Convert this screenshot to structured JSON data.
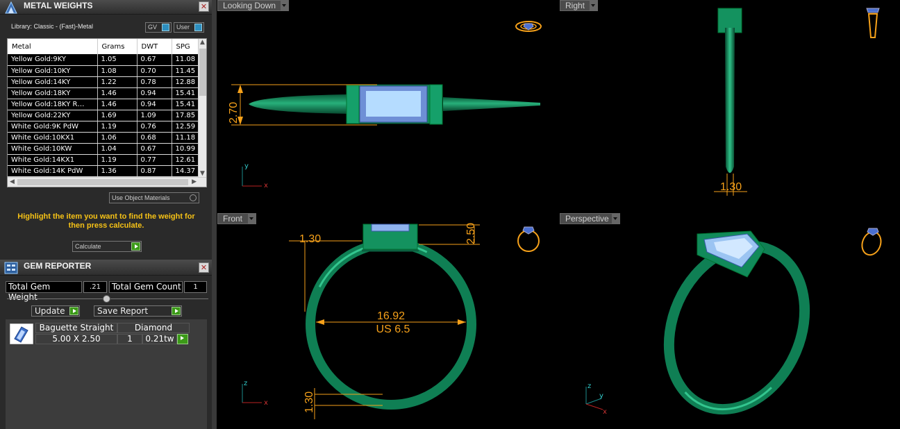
{
  "metal_weights": {
    "title": "METAL WEIGHTS",
    "library_label": "Library: Classic - (Fast)-Metal",
    "toggle_gv": "GV",
    "toggle_user": "User",
    "columns": [
      "Metal",
      "Grams",
      "DWT",
      "SPG"
    ],
    "rows": [
      [
        "Yellow Gold:9KY",
        "1.05",
        "0.67",
        "11.08"
      ],
      [
        "Yellow Gold:10KY",
        "1.08",
        "0.70",
        "11.45"
      ],
      [
        "Yellow Gold:14KY",
        "1.22",
        "0.78",
        "12.88"
      ],
      [
        "Yellow Gold:18KY",
        "1.46",
        "0.94",
        "15.41"
      ],
      [
        "Yellow Gold:18KY R…",
        "1.46",
        "0.94",
        "15.41"
      ],
      [
        "Yellow Gold:22KY",
        "1.69",
        "1.09",
        "17.85"
      ],
      [
        "White Gold:9K PdW",
        "1.19",
        "0.76",
        "12.59"
      ],
      [
        "White Gold:10KX1",
        "1.06",
        "0.68",
        "11.18"
      ],
      [
        "White Gold:10KW",
        "1.04",
        "0.67",
        "10.99"
      ],
      [
        "White Gold:14KX1",
        "1.19",
        "0.77",
        "12.61"
      ],
      [
        "White Gold:14K PdW",
        "1.36",
        "0.87",
        "14.37"
      ]
    ],
    "use_object_materials": "Use Object Materials",
    "hint": "Highlight the item you want to find the weight for then press calculate.",
    "calculate_label": "Calculate"
  },
  "gem_reporter": {
    "title": "GEM REPORTER",
    "total_weight_label": "Total Gem Weight",
    "total_weight_value": ".21",
    "total_count_label": "Total Gem Count",
    "total_count_value": "1",
    "update_label": "Update",
    "save_report_label": "Save Report",
    "gem": {
      "shape": "Baguette Straight",
      "material": "Diamond",
      "size": "5.00 X 2.50",
      "count": "1",
      "weight": "0.21tw"
    }
  },
  "viewports": {
    "top_left": {
      "label": "Looking Down",
      "dim_height": "2.70",
      "axis_a": "y",
      "axis_b": "x"
    },
    "top_right": {
      "label": "Right",
      "dim_width": "1.30"
    },
    "bottom_left": {
      "label": "Front",
      "dim_top_width": "1.30",
      "dim_head_height": "2.50",
      "dim_bottom": "1.30",
      "diameter": "16.92",
      "ring_size": "US 6.5",
      "axis_a": "z",
      "axis_b": "x"
    },
    "bottom_right": {
      "label": "Perspective",
      "axis_z": "z",
      "axis_y": "y",
      "axis_x": "x"
    }
  },
  "colors": {
    "metal_green": "#0f8a5c",
    "gem_blue": "#9fcdf5",
    "dimension": "#f6a11a",
    "hint_text": "#f6c216"
  }
}
